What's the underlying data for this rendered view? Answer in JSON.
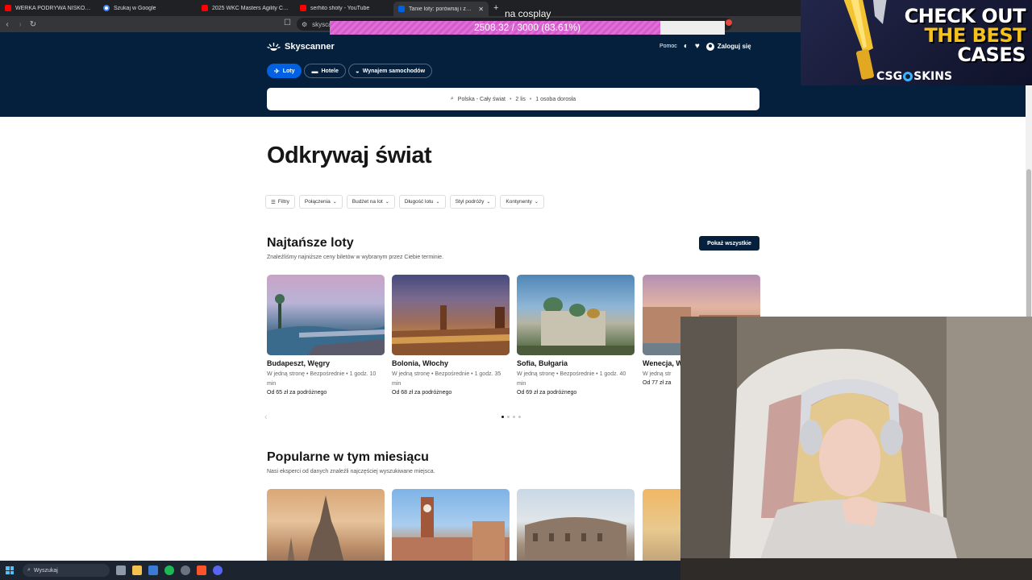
{
  "browser": {
    "tabs": [
      {
        "label": "WERKA PODRYWA NISKOROSŁYCH",
        "favicon": "youtube-icon",
        "active": false
      },
      {
        "label": "Szukaj w Google",
        "favicon": "google-icon",
        "active": false
      },
      {
        "label": "2025 WKC Masters Agility Champion",
        "favicon": "youtube-icon",
        "active": false
      },
      {
        "label": "serhito shoty - YouTube",
        "favicon": "youtube-icon",
        "active": false
      },
      {
        "label": "Tanie loty: porównaj i zarezerwuj",
        "favicon": "skyscanner-icon",
        "active": true
      }
    ],
    "address": "skysca"
  },
  "overlay": {
    "goal_label": "na cosplay",
    "goal_text": "2508.32 / 3000 (83.61%)",
    "goal_fraction": 0.8361,
    "ad_line1": "CHECK OUT",
    "ad_line2": "THE BEST",
    "ad_line3": "CASES",
    "ad_brand_a": "CSG",
    "ad_brand_b": "SKINS"
  },
  "header": {
    "logo": "Skyscanner",
    "help": "Pomoc",
    "login": "Zaloguj się",
    "tabs": [
      "Loty",
      "Hotele",
      "Wynajem samochodów"
    ],
    "search": {
      "route": "Polska - Cały świat",
      "dates": "2 lis",
      "travellers": "1 osoba dorosła"
    }
  },
  "main": {
    "title": "Odkrywaj świat",
    "filters": [
      "Filtry",
      "Połączenia",
      "Budżet na lot",
      "Długość lotu",
      "Styl podróży",
      "Kontynenty"
    ],
    "cheapest": {
      "title": "Najtańsze loty",
      "subtitle": "Znaleźliśmy najniższe ceny biletów w wybranym przez Ciebie terminie.",
      "show_all": "Pokaż wszystkie",
      "cards": [
        {
          "city": "Budapeszt, Węgry",
          "meta": "W jedną stronę • Bezpośrednie • 1 godz. 10 min",
          "price": "Od 65 zł za podróżnego"
        },
        {
          "city": "Bolonia, Włochy",
          "meta": "W jedną stronę • Bezpośrednie • 1 godz. 35 min",
          "price": "Od 68 zł za podróżnego"
        },
        {
          "city": "Sofia, Bułgaria",
          "meta": "W jedną stronę • Bezpośrednie • 1 godz. 40 min",
          "price": "Od 69 zł za podróżnego"
        },
        {
          "city": "Wenecja, W",
          "meta": "W jedną str",
          "price": "Od 77 zł za"
        }
      ]
    },
    "popular": {
      "title": "Popularne w tym miesiącu",
      "subtitle": "Nasi eksperci od danych znaleźli najczęściej wyszukiwane miejsca."
    }
  },
  "taskbar": {
    "search_placeholder": "Wyszukaj"
  }
}
